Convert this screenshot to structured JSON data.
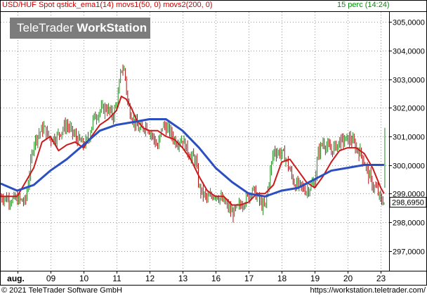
{
  "header": {
    "title": "USD/HUF Spot qstick_ema1(14) movs1(50, 0) movs2(200, 0)",
    "interval": "15 perc (14:24)"
  },
  "logo": {
    "part1": "TeleTrader ",
    "part2": "WorkStation"
  },
  "footer": {
    "copyright": "© 2021 TeleTrader Software GmbH",
    "url": "https://workstation.teletrader.com/"
  },
  "colors": {
    "price_up": "#1f8c1f",
    "price_down": "#b01010",
    "ema": "#cc1a1a",
    "sma": "#2b4fc0",
    "grid": "#999999",
    "last_label_bg": "#ffffff"
  },
  "chart_data": {
    "type": "line",
    "y_ticks": [
      "305,0000",
      "304,0000",
      "303,0000",
      "302,0000",
      "301,0000",
      "300,0000",
      "299,0000",
      "298,0000",
      "297,0000"
    ],
    "y_tick_values": [
      305,
      304,
      303,
      302,
      301,
      300,
      299,
      298,
      297
    ],
    "ylim": [
      296.3,
      305.35
    ],
    "x_ticks": [
      "aug.",
      "09",
      "10",
      "11",
      "12",
      "13",
      "16",
      "17",
      "18",
      "19",
      "20",
      "23"
    ],
    "x_tick_positions": [
      0.5,
      1.5,
      2.5,
      3.5,
      4.5,
      5.5,
      6.5,
      7.5,
      8.5,
      9.5,
      10.5,
      11.5
    ],
    "xlim": [
      0,
      11.75
    ],
    "last_value": "298,6950",
    "last_value_num": 298.695,
    "grid": true,
    "series": [
      {
        "name": "USD/HUF Spot",
        "role": "price",
        "x": [
          0.0,
          0.25,
          0.5,
          0.75,
          1.0,
          1.15,
          1.3,
          1.5,
          1.7,
          1.9,
          2.0,
          2.25,
          2.5,
          2.65,
          2.8,
          3.0,
          3.2,
          3.4,
          3.55,
          3.65,
          3.75,
          3.85,
          4.0,
          4.2,
          4.4,
          4.6,
          4.75,
          4.9,
          5.1,
          5.3,
          5.5,
          5.6,
          5.75,
          5.9,
          6.0,
          6.25,
          6.5,
          6.75,
          6.9,
          7.0,
          7.25,
          7.5,
          7.6,
          7.75,
          7.9,
          8.0,
          8.25,
          8.5,
          8.6,
          8.75,
          8.9,
          9.0,
          9.25,
          9.5,
          9.6,
          9.75,
          9.9,
          10.0,
          10.25,
          10.5,
          10.6,
          10.75,
          10.9,
          11.0,
          11.15,
          11.25,
          11.4,
          11.5,
          11.55,
          11.6
        ],
        "y": [
          298.9,
          298.8,
          298.8,
          298.7,
          300.8,
          301.1,
          301.3,
          300.9,
          301.0,
          301.3,
          301.4,
          301.0,
          300.7,
          300.9,
          301.6,
          301.9,
          302.0,
          301.7,
          302.4,
          303.4,
          303.3,
          302.1,
          301.6,
          301.2,
          301.4,
          301.0,
          300.6,
          301.4,
          301.2,
          300.8,
          300.9,
          300.6,
          300.3,
          300.2,
          299.2,
          298.8,
          299.0,
          298.7,
          298.5,
          298.3,
          298.6,
          298.9,
          299.2,
          298.9,
          298.6,
          298.5,
          300.5,
          300.4,
          300.3,
          299.8,
          299.3,
          299.3,
          299.1,
          299.4,
          300.4,
          300.8,
          300.6,
          300.5,
          300.8,
          300.9,
          300.9,
          300.6,
          300.4,
          300.1,
          299.6,
          299.3,
          299.1,
          298.7,
          298.8,
          298.7
        ]
      },
      {
        "name": "qstick_ema1(14)",
        "role": "ema",
        "x": [
          0.0,
          0.5,
          1.0,
          1.25,
          1.5,
          1.75,
          2.0,
          2.25,
          2.5,
          2.75,
          3.0,
          3.25,
          3.5,
          3.65,
          3.8,
          3.95,
          4.1,
          4.3,
          4.5,
          4.75,
          5.0,
          5.25,
          5.5,
          5.75,
          6.0,
          6.25,
          6.5,
          6.75,
          7.0,
          7.25,
          7.5,
          7.75,
          8.0,
          8.25,
          8.5,
          8.75,
          9.0,
          9.25,
          9.5,
          9.75,
          10.0,
          10.25,
          10.5,
          10.75,
          11.0,
          11.25,
          11.5,
          11.6
        ],
        "y": [
          298.9,
          298.9,
          299.9,
          300.8,
          301.0,
          300.5,
          300.7,
          300.8,
          300.6,
          301.0,
          301.4,
          301.6,
          301.9,
          302.4,
          302.3,
          302.0,
          301.6,
          301.3,
          301.2,
          301.2,
          301.0,
          300.9,
          300.6,
          300.2,
          299.6,
          299.1,
          298.9,
          298.9,
          298.6,
          298.6,
          298.7,
          299.0,
          299.0,
          299.3,
          300.1,
          300.2,
          299.8,
          299.4,
          299.2,
          299.6,
          300.1,
          300.5,
          300.6,
          300.6,
          300.4,
          299.9,
          299.2,
          299.0
        ]
      },
      {
        "name": "movs1(50, 0)",
        "role": "sma",
        "x": [
          0.0,
          0.5,
          1.0,
          1.5,
          2.0,
          2.5,
          3.0,
          3.5,
          4.0,
          4.5,
          5.0,
          5.5,
          6.0,
          6.5,
          7.0,
          7.5,
          8.0,
          8.5,
          9.0,
          9.5,
          10.0,
          10.5,
          11.0,
          11.5,
          11.6
        ],
        "y": [
          299.35,
          299.1,
          299.3,
          299.8,
          300.2,
          300.7,
          301.2,
          301.4,
          301.5,
          301.6,
          301.6,
          301.2,
          300.6,
          299.9,
          299.4,
          299.0,
          298.9,
          299.1,
          299.2,
          299.5,
          299.8,
          299.9,
          300.0,
          300.0,
          300.0
        ]
      }
    ]
  }
}
